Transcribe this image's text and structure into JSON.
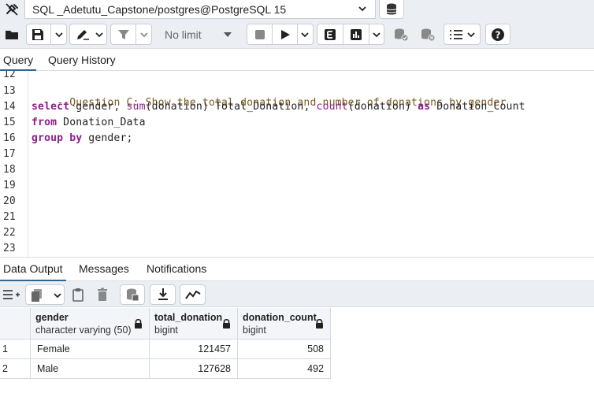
{
  "connection": {
    "label": "SQL _Adetutu_Capstone/postgres@PostgreSQL 15"
  },
  "toolbar": {
    "limit_value": "No limit"
  },
  "query_tabs": [
    {
      "label": "Query",
      "active": true
    },
    {
      "label": "Query History",
      "active": false
    }
  ],
  "editor": {
    "line_numbers": [
      "12",
      "13",
      "14",
      "15",
      "16",
      "17",
      "18",
      "19",
      "20",
      "21",
      "22",
      "23"
    ],
    "lines": [
      {
        "num": "13",
        "tokens": [
          {
            "t": "--Question C: Show the total donation and number of donations by gender",
            "c": "cmt"
          }
        ]
      },
      {
        "num": "14",
        "tokens": [
          {
            "t": "select",
            "c": "kw"
          },
          {
            "t": " gender, ",
            "c": "plain"
          },
          {
            "t": "sum",
            "c": "fn"
          },
          {
            "t": "(donation) Total_Donation, ",
            "c": "plain"
          },
          {
            "t": "count",
            "c": "fn"
          },
          {
            "t": "(donation) ",
            "c": "plain"
          },
          {
            "t": "as",
            "c": "kw"
          },
          {
            "t": " Donation_Count",
            "c": "plain"
          }
        ]
      },
      {
        "num": "15",
        "tokens": [
          {
            "t": "from",
            "c": "kw"
          },
          {
            "t": " Donation_Data",
            "c": "plain"
          }
        ]
      },
      {
        "num": "16",
        "tokens": [
          {
            "t": "group by",
            "c": "kw"
          },
          {
            "t": " gender;",
            "c": "plain"
          }
        ]
      }
    ]
  },
  "result_tabs": [
    {
      "label": "Data Output",
      "active": true
    },
    {
      "label": "Messages",
      "active": false
    },
    {
      "label": "Notifications",
      "active": false
    }
  ],
  "results": {
    "columns": [
      {
        "name": "gender",
        "type": "character varying (50)"
      },
      {
        "name": "total_donation",
        "type": "bigint"
      },
      {
        "name": "donation_count",
        "type": "bigint"
      }
    ],
    "rows": [
      {
        "n": "1",
        "gender": "Female",
        "total_donation": "121457",
        "donation_count": "508"
      },
      {
        "n": "2",
        "gender": "Male",
        "total_donation": "127628",
        "donation_count": "492"
      }
    ]
  },
  "colors": {
    "keyword": "#8b1e8b",
    "comment": "#7a5a1e",
    "active_tab_underline": "#326690",
    "toolbar_bg": "#ebeef3"
  },
  "icons": {
    "connection": "plug-off-icon",
    "database": "database-icon",
    "open_file": "folder-icon",
    "save": "floppy-disk-icon",
    "edit": "pencil-icon",
    "filter": "filter-icon",
    "stop": "stop-icon",
    "execute": "play-icon",
    "explain": "explain-icon",
    "explain_analyze": "bar-chart-icon",
    "commit": "database-check-icon",
    "rollback": "database-rollback-icon",
    "macros": "list-icon",
    "help": "help-icon",
    "add_row": "add-row-icon",
    "copy": "copy-icon",
    "paste": "paste-icon",
    "delete": "trash-icon",
    "save_data": "database-save-icon",
    "download": "download-icon",
    "graph": "graph-icon",
    "lock": "lock-icon"
  }
}
